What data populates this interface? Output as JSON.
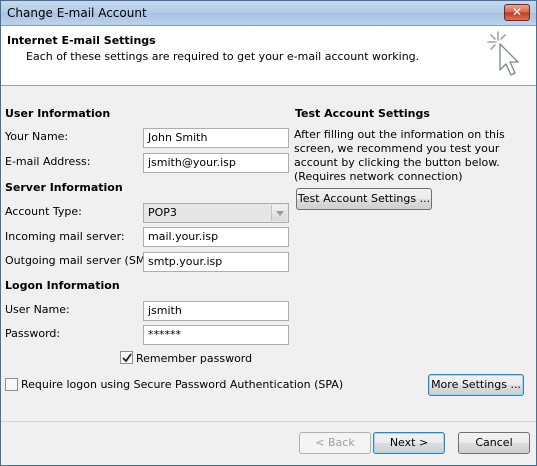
{
  "window": {
    "title": "Change E-mail Account",
    "close_glyph": "✕"
  },
  "header": {
    "title": "Internet E-mail Settings",
    "subtitle": "Each of these settings are required to get your e-mail account working.",
    "icon": "cursor-sparkle-icon"
  },
  "user_info": {
    "section": "User Information",
    "name_label": "Your Name:",
    "name_value": "John Smith",
    "email_label": "E-mail Address:",
    "email_value": "jsmith@your.isp"
  },
  "server_info": {
    "section": "Server Information",
    "account_type_label": "Account Type:",
    "account_type_value": "POP3",
    "incoming_label": "Incoming mail server:",
    "incoming_value": "mail.your.isp",
    "outgoing_label": "Outgoing mail server (SMTP):",
    "outgoing_value": "smtp.your.isp"
  },
  "logon_info": {
    "section": "Logon Information",
    "username_label": "User Name:",
    "username_value": "jsmith",
    "password_label": "Password:",
    "password_value": "******",
    "remember_label": "Remember password",
    "remember_checked": true,
    "spa_label": "Require logon using Secure Password Authentication (SPA)",
    "spa_checked": false
  },
  "test_settings": {
    "section": "Test Account Settings",
    "description": "After filling out the information on this screen, we recommend you test your account by clicking the button below. (Requires network connection)",
    "button_label": "Test Account Settings ..."
  },
  "buttons": {
    "more_settings": "More Settings ...",
    "back": "< Back",
    "next": "Next >",
    "cancel": "Cancel"
  }
}
